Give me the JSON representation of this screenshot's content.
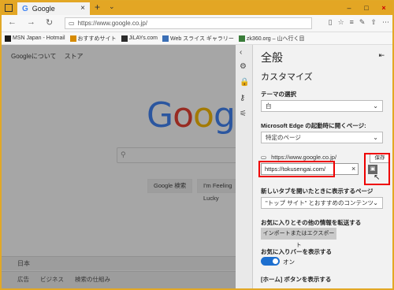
{
  "tab": {
    "label": "Google",
    "icon": "google-g-icon",
    "close": "×"
  },
  "window_controls": {
    "minimize": "–",
    "maximize": "□",
    "close": "×"
  },
  "address": {
    "back": "←",
    "forward": "→",
    "refresh": "↻",
    "url": "https://www.google.co.jp/"
  },
  "favorites": [
    {
      "label": "MSN Japan - Hotmail",
      "color": "#1a1a1a"
    },
    {
      "label": "おすすめサイト",
      "color": "#d68a00"
    },
    {
      "label": "JiLAYs.com",
      "color": "#2b2b2b"
    },
    {
      "label": "Web スライス ギャラリー",
      "color": "#3b6fb6"
    },
    {
      "label": "zk360.org – 山へ行く目",
      "color": "#3a7d3a"
    }
  ],
  "google_page": {
    "top_links": [
      "Googleについて",
      "ストア"
    ],
    "logo_letters": [
      {
        "ch": "G",
        "color": "#4285f4"
      },
      {
        "ch": "o",
        "color": "#ea4335"
      },
      {
        "ch": "o",
        "color": "#fbbc05"
      },
      {
        "ch": "g",
        "color": "#4285f4"
      },
      {
        "ch": "l",
        "color": "#34a853"
      },
      {
        "ch": "e",
        "color": "#ea4335"
      }
    ],
    "search_button": "Google 検索",
    "lucky_button": "I'm Feeling Lucky",
    "footer_country": "日本",
    "footer_links": [
      "広告",
      "ビジネス",
      "検索の仕組み"
    ]
  },
  "settings": {
    "title": "全般",
    "subtitle": "カスタマイズ",
    "theme_label": "テーマの選択",
    "theme_value": "白",
    "startup_label": "Microsoft Edge の起動時に開くページ:",
    "startup_value": "特定のページ",
    "existing_url": "https://www.google.co.jp/",
    "new_url_input": "https://tokusengai.com/",
    "save_tooltip": "保存",
    "newtab_label": "新しいタブを開いたときに表示するページ",
    "newtab_value": "\"トップ サイト\" とおすすめのコンテンツ",
    "transfer_label": "お気に入りとその他の情報を転送する",
    "import_button": "インポートまたはエクスポート",
    "favbar_label": "お気に入りバーを表示する",
    "favbar_toggle": "オン",
    "home_label": "[ホーム] ボタンを表示する"
  }
}
